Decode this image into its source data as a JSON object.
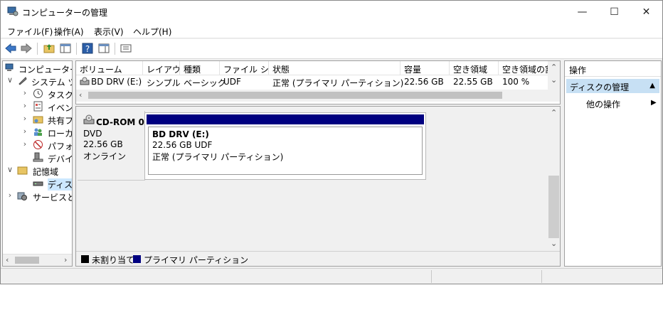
{
  "window": {
    "title": "コンピューターの管理",
    "minimize_glyph": "—",
    "maximize_glyph": "☐",
    "close_glyph": "✕"
  },
  "menu": [
    "ファイル(F)",
    "操作(A)",
    "表示(V)",
    "ヘルプ(H)"
  ],
  "toolbar_icons": [
    "back-arrow-icon",
    "forward-arrow-icon",
    "up-folder-icon",
    "show-hide-tree-icon",
    "help-icon",
    "show-hide-action-pane-icon",
    "properties-icon"
  ],
  "tree": {
    "items": [
      {
        "label": "コンピューターの管理 (ローカル)",
        "expander": "",
        "icon": "computer-management-icon",
        "selected": false
      },
      {
        "label": "システム ツール",
        "expander": "∨",
        "icon": "system-tools-icon",
        "selected": false
      },
      {
        "label": "タスク スケジューラ",
        "expander": "›",
        "icon": "task-scheduler-icon",
        "selected": false
      },
      {
        "label": "イベント ビューアー",
        "expander": "›",
        "icon": "event-viewer-icon",
        "selected": false
      },
      {
        "label": "共有フォルダー",
        "expander": "›",
        "icon": "shared-folders-icon",
        "selected": false
      },
      {
        "label": "ローカル ユーザーとグループ",
        "expander": "›",
        "icon": "local-users-icon",
        "selected": false
      },
      {
        "label": "パフォーマンス",
        "expander": "›",
        "icon": "performance-icon",
        "selected": false
      },
      {
        "label": "デバイス マネージャー",
        "expander": "",
        "icon": "device-manager-icon",
        "selected": false
      },
      {
        "label": "記憶域",
        "expander": "∨",
        "icon": "storage-icon",
        "selected": false
      },
      {
        "label": "ディスクの管理",
        "expander": "",
        "icon": "disk-management-icon",
        "selected": true
      },
      {
        "label": "サービスとアプリケーション",
        "expander": "›",
        "icon": "services-icon",
        "selected": false
      }
    ]
  },
  "volumes": {
    "columns": [
      "ボリューム",
      "レイアウト",
      "種類",
      "ファイル システム",
      "状態",
      "容量",
      "空き領域",
      "空き領域の割合"
    ],
    "rows": [
      {
        "volume": "BD DRV (E:)",
        "layout": "シンプル",
        "type": "ベーシック",
        "fs": "UDF",
        "status": "正常 (プライマリ パーティション)",
        "capacity": "22.56 GB",
        "free": "22.55 GB",
        "free_pct": "100 %"
      }
    ]
  },
  "disk": {
    "name": "CD-ROM 0",
    "kind": "DVD",
    "size": "22.56 GB",
    "state": "オンライン",
    "partition": {
      "name": "BD DRV  (E:)",
      "size_fs": "22.56 GB UDF",
      "status": "正常 (プライマリ パーティション)",
      "header_color": "#000080"
    }
  },
  "legend": [
    {
      "label": "未割り当て",
      "color": "#000000"
    },
    {
      "label": "プライマリ パーティション",
      "color": "#000080"
    }
  ],
  "actions": {
    "header": "操作",
    "section": "ディスクの管理",
    "section_glyph": "▲",
    "item": "他の操作",
    "item_glyph": "▶"
  },
  "scroll_glyphs": {
    "left": "‹",
    "right": "›",
    "up": "⌃",
    "down": "⌄"
  }
}
